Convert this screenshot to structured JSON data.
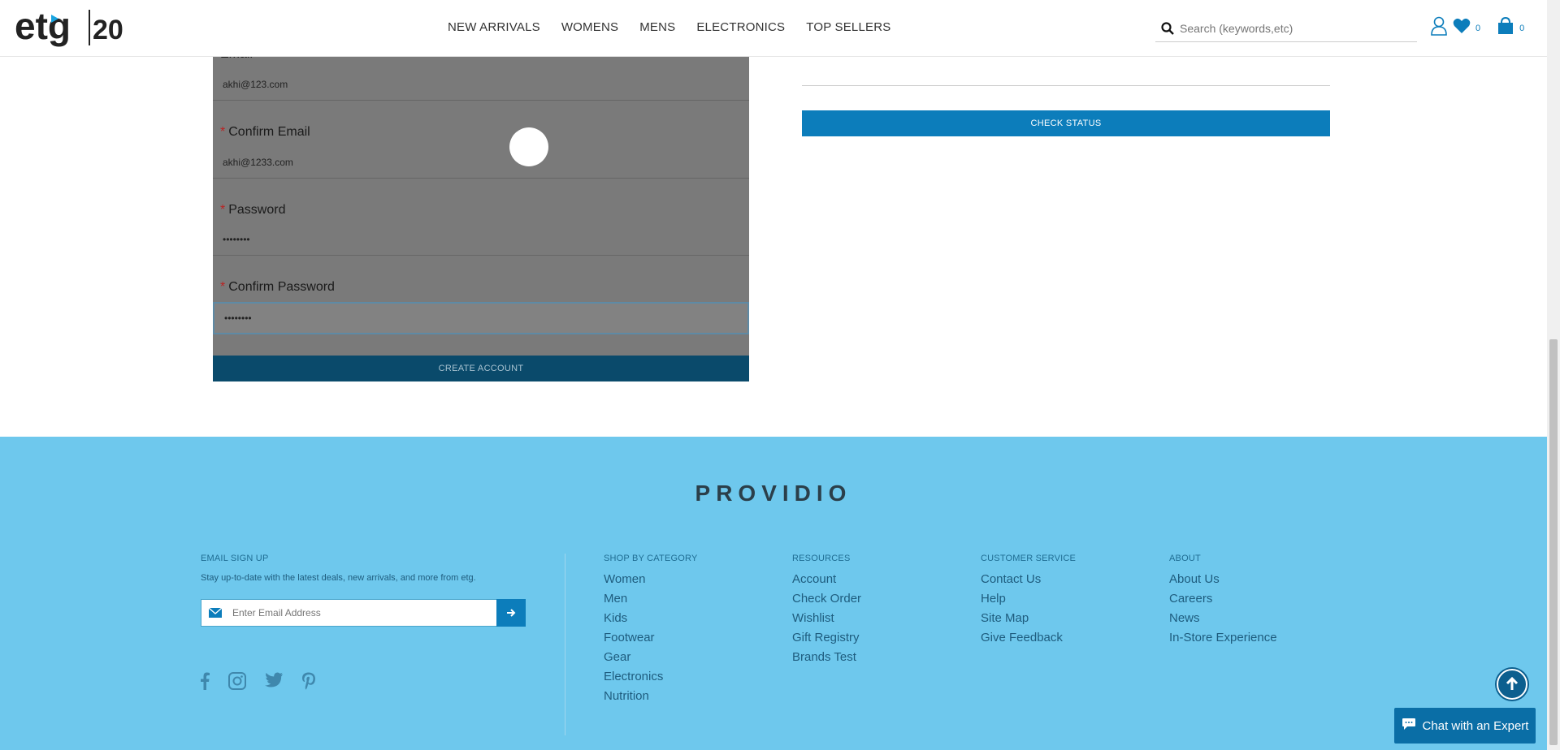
{
  "header": {
    "logo_text": "etg",
    "logo_badge": "20",
    "nav": [
      "NEW ARRIVALS",
      "WOMENS",
      "MENS",
      "ELECTRONICS",
      "TOP SELLERS"
    ],
    "search_placeholder": "Search (keywords,etc)",
    "wishlist_count": "0",
    "cart_count": "0",
    "icons": [
      "search-icon",
      "user-icon",
      "heart-icon",
      "bag-icon"
    ]
  },
  "form": {
    "email_label": "Email",
    "email_value": "akhi@123.com",
    "confirm_email_label": "Confirm Email",
    "confirm_email_value": "akhi@1233.com",
    "password_label": "Password",
    "password_value": "••••••••",
    "confirm_password_label": "Confirm Password",
    "confirm_password_value": "••••••••",
    "required_mark": "*",
    "create_account": "CREATE ACCOUNT"
  },
  "status": {
    "check_status": "CHECK STATUS"
  },
  "footer": {
    "brand": "PROVIDIO",
    "email_signup": {
      "heading": "EMAIL SIGN UP",
      "description": "Stay up-to-date with the latest deals, new arrivals, and more from etg.",
      "placeholder": "Enter Email Address"
    },
    "columns": [
      {
        "heading": "SHOP BY CATEGORY",
        "items": [
          "Women",
          "Men",
          "Kids",
          "Footwear",
          "Gear",
          "Electronics",
          "Nutrition"
        ]
      },
      {
        "heading": "RESOURCES",
        "items": [
          "Account",
          "Check Order",
          "Wishlist",
          "Gift Registry",
          "Brands Test"
        ]
      },
      {
        "heading": "CUSTOMER SERVICE",
        "items": [
          "Contact Us",
          "Help",
          "Site Map",
          "Give Feedback"
        ]
      },
      {
        "heading": "ABOUT",
        "items": [
          "About Us",
          "Careers",
          "News",
          "In-Store Experience"
        ]
      }
    ],
    "social": [
      "facebook-icon",
      "instagram-icon",
      "twitter-icon",
      "pinterest-icon"
    ],
    "chat_label": "Chat with an Expert"
  },
  "colors": {
    "accent": "#0c7dbb",
    "footer_bg": "#6ec8ed",
    "dark_button": "#0a4a6b"
  }
}
